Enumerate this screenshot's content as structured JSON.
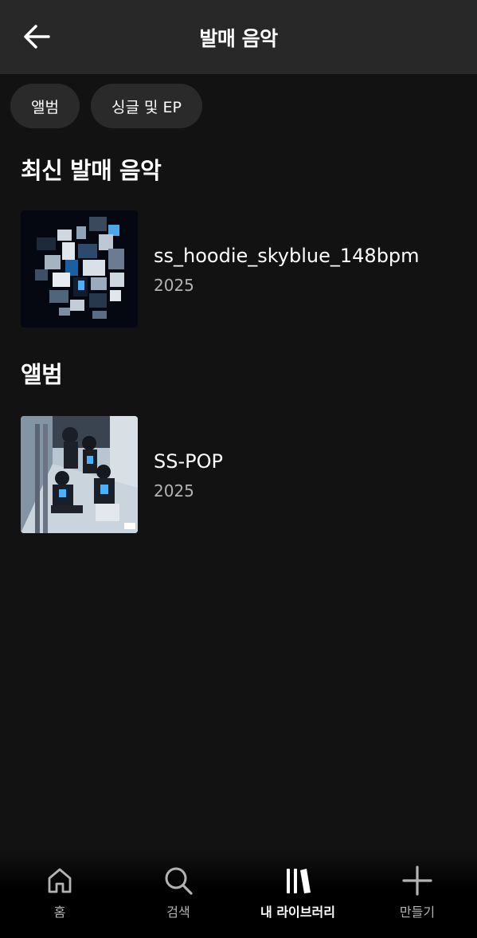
{
  "header": {
    "title": "발매 음악"
  },
  "filters": [
    {
      "label": "앨범"
    },
    {
      "label": "싱글 및 EP"
    }
  ],
  "sections": {
    "latest": {
      "title": "최신 발매 음악",
      "items": [
        {
          "title": "ss_hoodie_skyblue_148bpm",
          "year": "2025"
        }
      ]
    },
    "albums": {
      "title": "앨범",
      "items": [
        {
          "title": "SS-POP",
          "year": "2025"
        }
      ]
    }
  },
  "nav": {
    "items": [
      {
        "label": "홈",
        "icon": "home-icon",
        "active": false
      },
      {
        "label": "검색",
        "icon": "search-icon",
        "active": false
      },
      {
        "label": "내 라이브러리",
        "icon": "library-icon",
        "active": true
      },
      {
        "label": "만들기",
        "icon": "plus-icon",
        "active": false
      }
    ]
  },
  "colors": {
    "background": "#121212",
    "header": "#282828",
    "chip": "#2a2a2a",
    "secondary_text": "#b3b3b3"
  }
}
